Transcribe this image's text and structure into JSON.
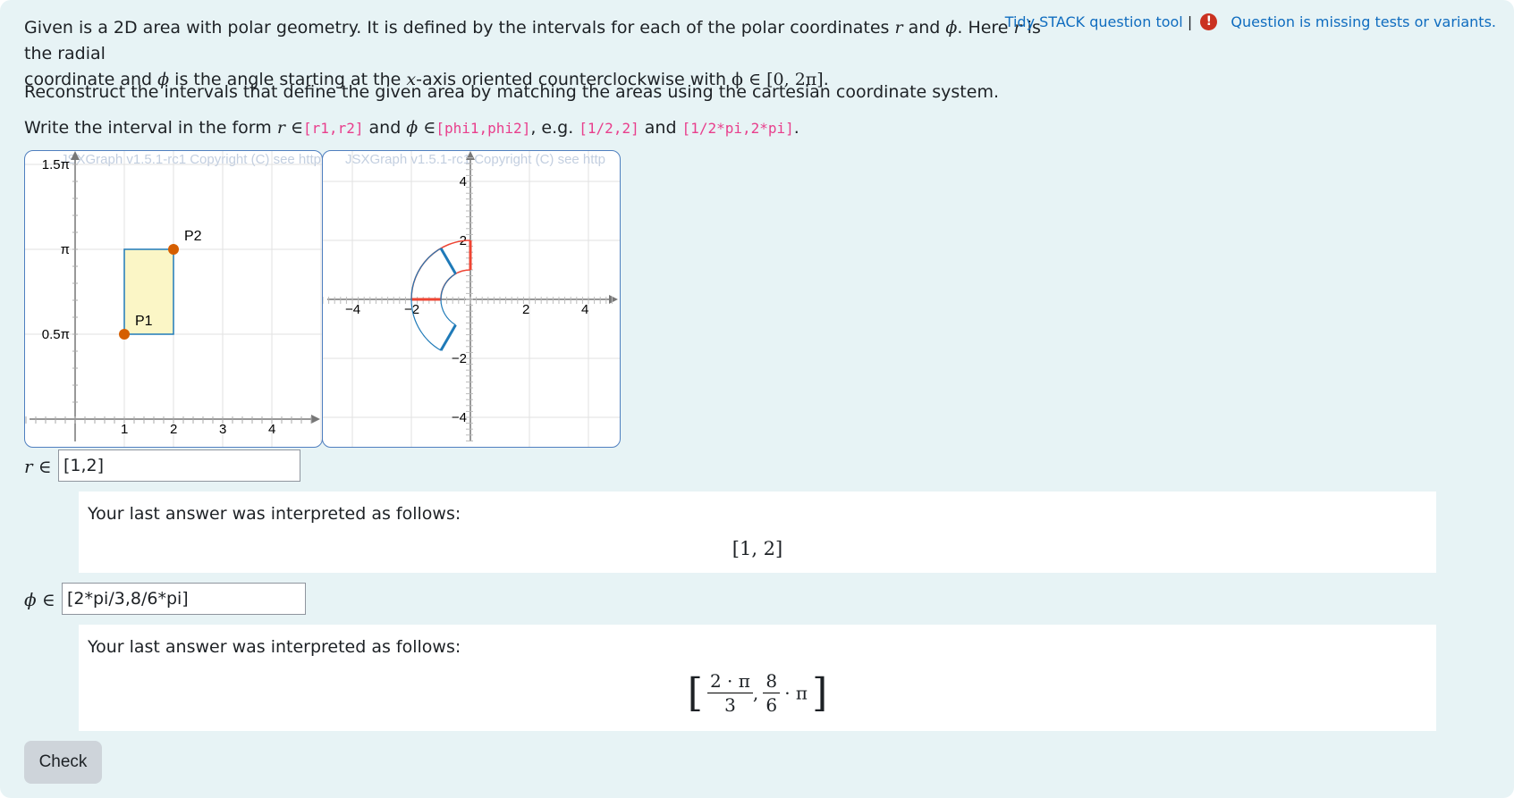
{
  "intro": {
    "p1_a": "Given is a 2D area with polar geometry. It is defined by the intervals for each of the polar coordinates ",
    "r": "r",
    "and": " and ",
    "phi": "ϕ",
    "p1_b": ". Here ",
    "p1_c": " is the radial",
    "p2_a": "coordinate and ",
    "p2_b": " is the angle starting at the ",
    "x": "x",
    "p2_c": "-axis oriented counterclockwise with ",
    "phi_range": "ϕ ∈ [0, 2π]",
    "p2_d": ".",
    "p3": "Reconstruct the intervals that define the given area by matching the areas using the cartesian coordinate system.",
    "p4_a": "Write the interval in the form ",
    "in": " ∈",
    "code_r": "[r1,r2]",
    "code_phi": "[phi1,phi2]",
    "p4_b": ", e.g. ",
    "code_ex1": "[1/2,2]",
    "code_ex2": "[1/2*pi,2*pi]",
    "p4_c": "."
  },
  "toplinks": {
    "tidy": "Tidy STACK question tool",
    "sep": "|",
    "warning": "Question is missing tests or variants.",
    "warn_icon": "exclamation-circle-icon"
  },
  "graphs": {
    "copyright": "JSXGraph v1.5.1-rc1 Copyright (C) see http",
    "left": {
      "xticks": [
        "1",
        "2",
        "3",
        "4"
      ],
      "yticks": [
        "0.5π",
        "π",
        "1.5π"
      ],
      "points": [
        {
          "label": "P1",
          "r": 1,
          "phi": "0.5π"
        },
        {
          "label": "P2",
          "r": 2,
          "phi": "π"
        }
      ],
      "fill": "#fbf6c6",
      "point_color": "#d55e00"
    },
    "right": {
      "xticks": [
        "−4",
        "−2",
        "2",
        "4"
      ],
      "yticks": [
        "4",
        "2",
        "−2",
        "−4"
      ],
      "target_color": "#ee4433",
      "answer_color": "#1f7ab8"
    }
  },
  "answers": [
    {
      "label_var": "r",
      "label_in": " ∈",
      "value": "[1,2]",
      "feedback": "Your last answer was interpreted as follows:",
      "display": "[1, 2]"
    },
    {
      "label_var": "ϕ",
      "label_in": " ∈",
      "value": "[2*pi/3,8/6*pi]",
      "feedback": "Your last answer was interpreted as follows:",
      "display": {
        "n1": "2 · π",
        "d1": "3",
        "n2": "8",
        "d2": "6",
        "tail": "· π"
      }
    }
  ],
  "check_label": "Check"
}
